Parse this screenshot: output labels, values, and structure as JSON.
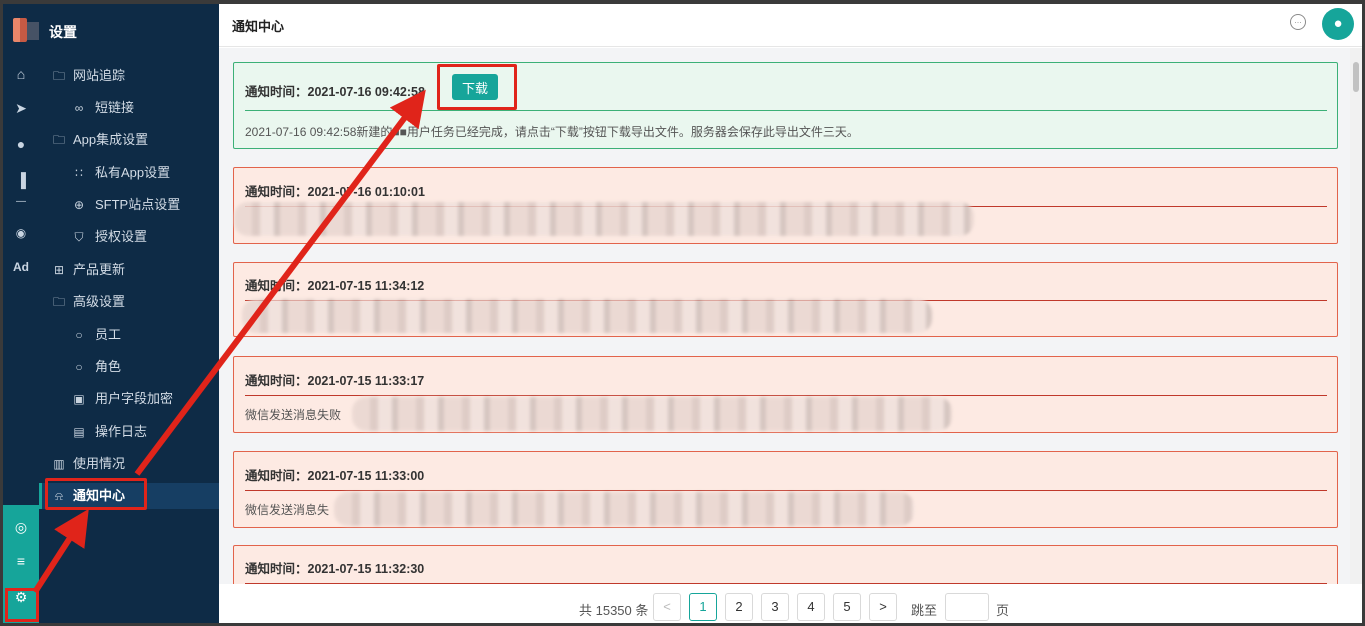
{
  "sidebar": {
    "title": "设置",
    "items": [
      {
        "label": "网站追踪",
        "icon": "folder-icon"
      },
      {
        "label": "短链接",
        "icon": "link-icon"
      },
      {
        "label": "App集成设置",
        "icon": "folder-icon"
      },
      {
        "label": "私有App设置",
        "icon": "apps-icon"
      },
      {
        "label": "SFTP站点设置",
        "icon": "globe-icon"
      },
      {
        "label": "授权设置",
        "icon": "shield-icon"
      },
      {
        "label": "产品更新",
        "icon": "grid-icon"
      },
      {
        "label": "高级设置",
        "icon": "folder-icon"
      },
      {
        "label": "员工",
        "icon": "user-icon"
      },
      {
        "label": "角色",
        "icon": "role-icon"
      },
      {
        "label": "用户字段加密",
        "icon": "encrypt-icon"
      },
      {
        "label": "操作日志",
        "icon": "log-icon"
      },
      {
        "label": "使用情况",
        "icon": "usage-icon"
      },
      {
        "label": "通知中心",
        "icon": "bell-icon"
      }
    ]
  },
  "rail": {
    "ad_label": "Ad"
  },
  "header": {
    "title": "通知中心"
  },
  "notifications": [
    {
      "time_label": "通知时间：2021-07-16 09:42:58",
      "download_label": "下载",
      "body": "2021-07-16 09:42:58新建的■■用户任务已经完成，请点击“下载”按钮下载导出文件。服务器会保存此导出文件三天。"
    },
    {
      "time_label": "通知时间：2021-07-16 01:10:01",
      "body": ""
    },
    {
      "time_label": "通知时间：2021-07-15 11:34:12",
      "body": ""
    },
    {
      "time_label": "通知时间：2021-07-15 11:33:17",
      "body": "微信发送消息失败"
    },
    {
      "time_label": "通知时间：2021-07-15 11:33:00",
      "body": "微信发送消息失"
    },
    {
      "time_label": "通知时间：2021-07-15 11:32:30",
      "body": ""
    }
  ],
  "pagination": {
    "total": "共 15350 条",
    "prev": "<",
    "pages": [
      "1",
      "2",
      "3",
      "4",
      "5"
    ],
    "current": "1",
    "next": ">",
    "jump_label": "跳至",
    "page_unit": "页"
  },
  "colors": {
    "sidebar_bg": "#0e2b46",
    "accent": "#16a59a",
    "annotation_red": "#e0241a",
    "success_card": "#eaf7ef",
    "error_card": "#fdeae3"
  }
}
